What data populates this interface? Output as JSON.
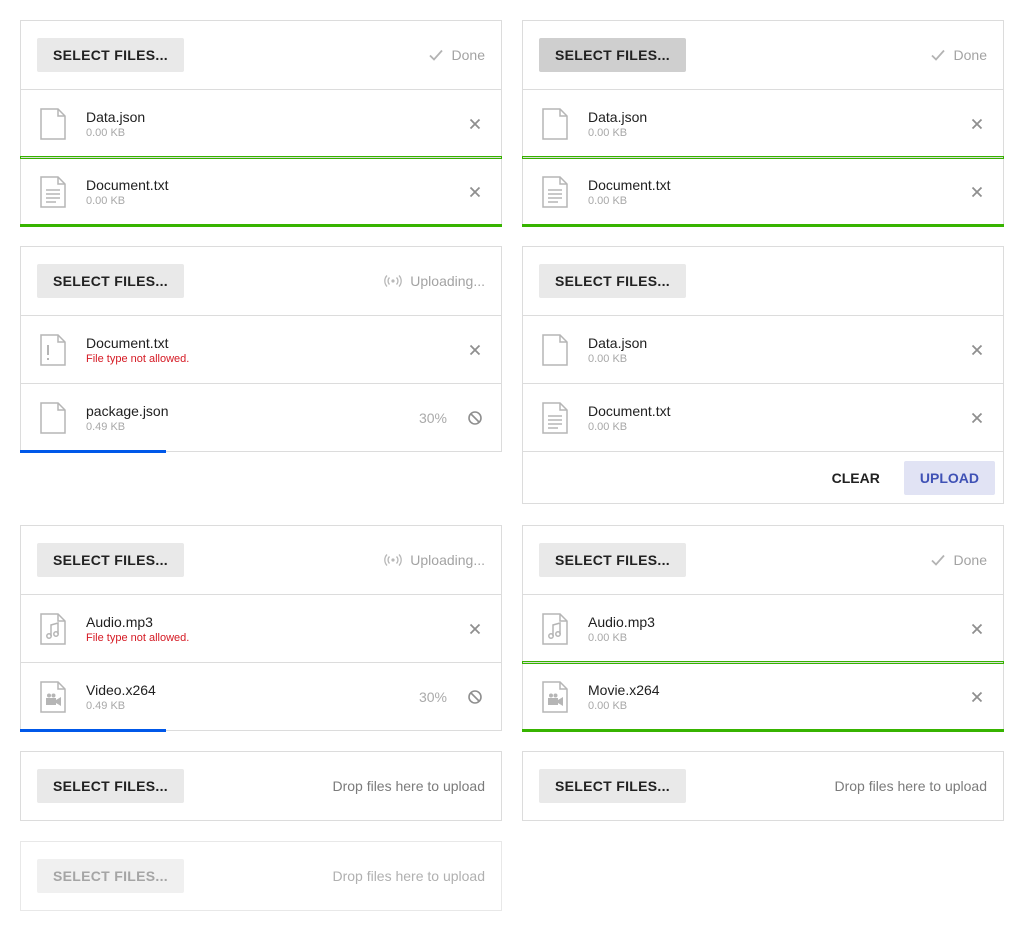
{
  "colors": {
    "success": "#37b400",
    "progress": "#0058e9",
    "error": "#d51923",
    "primary_text": "#3f51b5"
  },
  "select_label": "SELECT FILES...",
  "status": {
    "done": "Done",
    "uploading": "Uploading...",
    "drop": "Drop files here to upload"
  },
  "icons": {
    "done": "check-icon",
    "uploading": "loading-icon",
    "remove": "x-icon",
    "cancel": "cancel-icon",
    "file": "file-icon",
    "text": "file-text-icon",
    "error": "file-error-icon",
    "audio": "file-audio-icon",
    "video": "file-video-icon"
  },
  "p1": {
    "status": "Done",
    "files": [
      {
        "name": "Data.json",
        "size": "0.00 KB",
        "progress": 1.0
      },
      {
        "name": "Document.txt",
        "size": "0.00 KB",
        "progress": 1.0
      }
    ]
  },
  "p2": {
    "status": "Done",
    "files": [
      {
        "name": "Data.json",
        "size": "0.00 KB",
        "progress": 1.0
      },
      {
        "name": "Document.txt",
        "size": "0.00 KB",
        "progress": 1.0
      }
    ]
  },
  "p3": {
    "status": "Uploading...",
    "files": [
      {
        "name": "Document.txt",
        "error": "File type not allowed."
      },
      {
        "name": "package.json",
        "size": "0.49 KB",
        "percent": "30%",
        "progress": 0.3
      }
    ]
  },
  "p4": {
    "files": [
      {
        "name": "Data.json",
        "size": "0.00 KB"
      },
      {
        "name": "Document.txt",
        "size": "0.00 KB"
      }
    ],
    "clear_label": "CLEAR",
    "upload_label": "UPLOAD"
  },
  "p5": {
    "status": "Uploading...",
    "files": [
      {
        "name": "Audio.mp3",
        "error": "File type not allowed."
      },
      {
        "name": "Video.x264",
        "size": "0.49 KB",
        "percent": "30%",
        "progress": 0.3
      }
    ]
  },
  "p6": {
    "status": "Done",
    "files": [
      {
        "name": "Audio.mp3",
        "size": "0.00 KB",
        "progress": 1.0
      },
      {
        "name": "Movie.x264",
        "size": "0.00 KB",
        "progress": 1.0
      }
    ]
  },
  "p7": {
    "status": "Drop files here to upload"
  },
  "p8": {
    "status": "Drop files here to upload"
  },
  "p9": {
    "status": "Drop files here to upload",
    "disabled": true
  }
}
